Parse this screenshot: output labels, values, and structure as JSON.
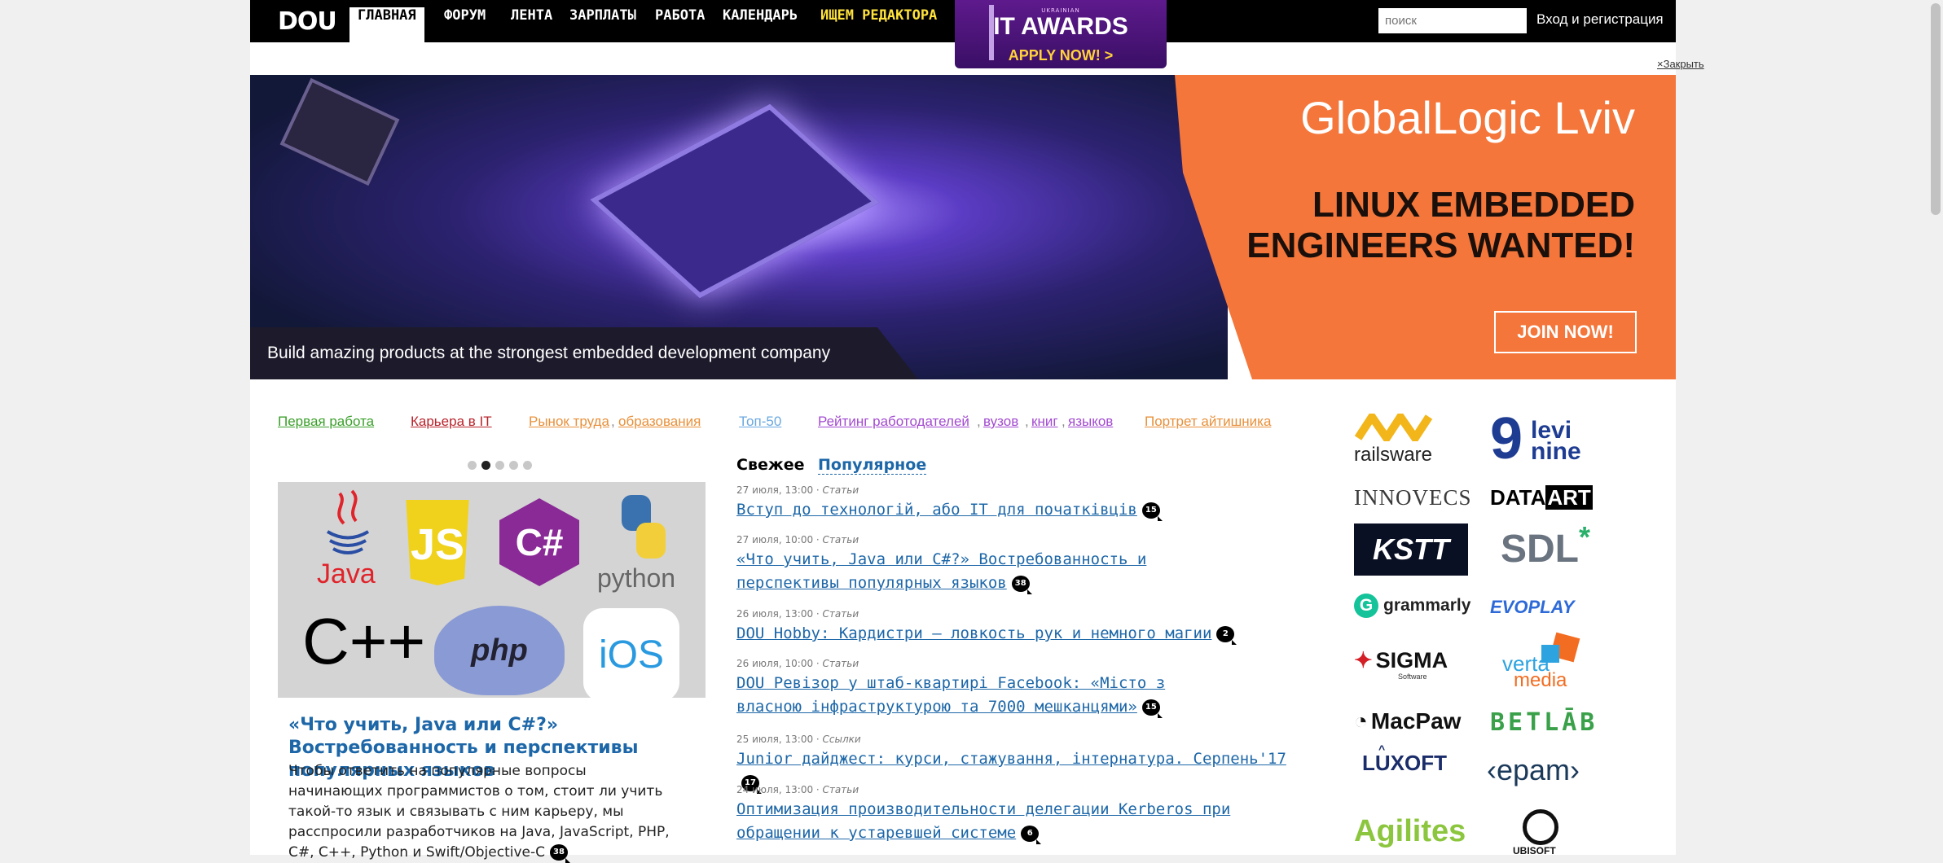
{
  "header": {
    "logo": "DOU",
    "nav": [
      {
        "label": "ГЛАВНАЯ"
      },
      {
        "label": "ФОРУМ"
      },
      {
        "label": "ЛЕНТА"
      },
      {
        "label": "ЗАРПЛАТЫ"
      },
      {
        "label": "РАБОТА"
      },
      {
        "label": "КАЛЕНДАРЬ"
      },
      {
        "label": "ИЩЕМ РЕДАКТОРА"
      }
    ],
    "awards": {
      "small": "UKRAINIAN",
      "big": "IT AWARDS",
      "apply": "APPLY NOW! >"
    },
    "search_placeholder": "поиск",
    "login": "Вход и регистрация",
    "close": "×Закрыть",
    "colors": {
      "bar": "#000000",
      "highlight": "#ffe23c"
    }
  },
  "banner": {
    "brand": "GlobalLogic Lviv",
    "headline": "LINUX EMBEDDED\nENGINEERS WANTED!",
    "button": "JOIN NOW!",
    "tagline": "Build amazing products at the strongest embedded development company",
    "colors": {
      "orange": "#f4763a"
    }
  },
  "tags": [
    {
      "label": "Первая работа",
      "color": "#3aa02a"
    },
    {
      "label": "Карьера в IT",
      "color": "#b8222a"
    },
    {
      "label": "Рынок труда",
      "color": "#e8903a"
    },
    {
      "label": "образования",
      "color": "#e8903a"
    },
    {
      "label": "Топ-50",
      "color": "#6aa8e0"
    },
    {
      "label": "Рейтинг работодателей",
      "color": "#a24ad0"
    },
    {
      "label": "вузов",
      "color": "#a24ad0"
    },
    {
      "label": "книг",
      "color": "#a24ad0"
    },
    {
      "label": "языков",
      "color": "#a24ad0"
    },
    {
      "label": "Портрет айтишника",
      "color": "#e8903a"
    }
  ],
  "slider": {
    "dots": 5,
    "active": 1,
    "image_labels": {
      "java": "Java",
      "js": "JS",
      "csharp": "C#",
      "python": "python",
      "cpp": "C++",
      "php": "php",
      "ios": "iOS"
    },
    "title": "«Что учить, Java или C#?» Востребованность и перспективы популярных языков",
    "text": "Чтобы ответить на популярные вопросы начинающих программистов о том, стоит ли учить такой-то язык и связывать с ним карьеру, мы расспросили разработчиков на Java, JavaScript, PHP, C#, C++, Python и Swift/Objective-C",
    "comments": "38"
  },
  "feed": {
    "tabs": {
      "fresh": "Свежее",
      "popular": "Популярное"
    },
    "articles": [
      {
        "date": "27 июля, 13:00",
        "category": "Статьи",
        "title": "Вступ до технологій, або IT для початківців",
        "comments": "15"
      },
      {
        "date": "27 июля, 10:00",
        "category": "Статьи",
        "title": "«Что учить, Java или C#?» Востребованность и перспективы популярных языков",
        "comments": "38"
      },
      {
        "date": "26 июля, 13:00",
        "category": "Статьи",
        "title": "DOU Hobby: Кардистри — ловкость рук и немного магии",
        "comments": "2"
      },
      {
        "date": "26 июля, 10:00",
        "category": "Статьи",
        "title": "DOU Ревізор у штаб-квартирі Facebook: «Місто з власною інфраструктурою та 7000 мешканцями»",
        "comments": "15"
      },
      {
        "date": "25 июля, 13:00",
        "category": "Ссылки",
        "title": "Junior дайджест: курси, стажування, інтернатура. Серпень'17",
        "comments": "17"
      },
      {
        "date": "24 июля, 13:00",
        "category": "Статьи",
        "title": "Оптимизация производительности делегации Kerberos при обращении к устаревшей системе",
        "comments": "6"
      }
    ]
  },
  "sponsors": {
    "railsware": "railsware",
    "levi_nine_num": "9",
    "levi_nine_a": "levi",
    "levi_nine_b": "nine",
    "innovecs": "INNOVECS",
    "dataart_a": "DATA",
    "dataart_b": "ART",
    "kst": "KSTT",
    "sdl": "SDL",
    "grammarly": "grammarly",
    "evoplay": "EVOPLAY",
    "sigma": "SIGMA",
    "sigma_sub": "Software",
    "verta_a": "verta",
    "verta_b": "media",
    "macpaw": "MacPaw",
    "betlab": "BETLĀB",
    "luxoft": "LUXOFT",
    "epam": "‹epam›",
    "agilites": "Agilites",
    "ubisoft": "UBISOFT"
  }
}
